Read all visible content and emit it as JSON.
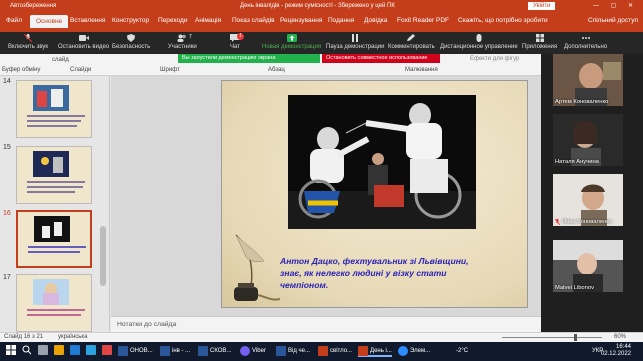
{
  "title_bar": {
    "autosave": "Автозбереження",
    "doc_title": "День інвалідів  -  режим сумісності  -  Збережено у цей ПК",
    "signin": "Увійти",
    "window_controls": "— ▢ ✕"
  },
  "ribbon_tabs": {
    "items": [
      "Файл",
      "Основне",
      "Вставлення",
      "Конструктор",
      "Переходи",
      "Анімація",
      "Показ слайдів",
      "Рецензування",
      "Подання",
      "Довідка",
      "Foxit Reader PDF"
    ],
    "active": "Основне",
    "tell_me": "Скажіть, що потрібно зробити",
    "share": "Спільний доступ"
  },
  "zoom_toolbar": {
    "items": [
      {
        "label": "Включить звук",
        "icon": "microphone-muted-icon"
      },
      {
        "label": "Остановить видео",
        "icon": "video-camera-icon"
      },
      {
        "label": "Безопасность",
        "icon": "shield-icon"
      },
      {
        "label": "Участники",
        "icon": "participants-icon",
        "count": "7"
      },
      {
        "label": "Чат",
        "icon": "chat-icon",
        "badge": "1"
      },
      {
        "label": "Новая демонстрация",
        "icon": "share-screen-icon"
      },
      {
        "label": "Пауза демонстрации",
        "icon": "pause-icon"
      },
      {
        "label": "Комментировать",
        "icon": "annotate-icon"
      },
      {
        "label": "Дистанционное управление",
        "icon": "remote-control-icon"
      },
      {
        "label": "Приложения",
        "icon": "apps-icon"
      },
      {
        "label": "Дополнительно",
        "icon": "more-icon"
      }
    ]
  },
  "ribbon_body": {
    "clipboard": "Буфер обміну",
    "slides": "Слайди",
    "slide_dropdown": "слайд",
    "font": "Шрифт",
    "paragraph": "Абзац",
    "drawing": "Малювання",
    "effects": "Ефекти для фігур",
    "share_banner": "Вы запустили демонстрацию экрана",
    "stop_banner": "Остановить совместное использование"
  },
  "thumbnails": [
    {
      "num": "14",
      "selected": false
    },
    {
      "num": "15",
      "selected": false
    },
    {
      "num": "16",
      "selected": true
    },
    {
      "num": "17",
      "selected": false
    }
  ],
  "slide": {
    "caption": "Антон Дацко, фехтувальник зі Львівщини, знає, як нелегко людині у візку стати чемпіоном.",
    "photo_icon": "wheelchair-fencing-photo"
  },
  "notes": "Нотатки до слайда",
  "participants": [
    {
      "name": "Артем Коноваленко",
      "muted": false
    },
    {
      "name": "Наталя Анучина",
      "muted": false
    },
    {
      "name": "Иван Коноваленко",
      "muted": true
    },
    {
      "name": "Matvei Libonov",
      "muted": false
    }
  ],
  "status_bar": {
    "slide_pos": "Слайд 16 з 21",
    "language": "українська",
    "zoom": "60%"
  },
  "taskbar": {
    "items": [
      {
        "label": "ОНОВ...",
        "color": "#2b579a"
      },
      {
        "label": "інв - ...",
        "color": "#2b579a"
      },
      {
        "label": "СКОВ...",
        "color": "#2b579a"
      },
      {
        "label": "Viber",
        "color": "#7360f2"
      },
      {
        "label": "Від че...",
        "color": "#2b579a"
      },
      {
        "label": "світло...",
        "color": "#c43e1c"
      },
      {
        "label": "День і...",
        "color": "#c43e1c"
      },
      {
        "label": "Элем...",
        "color": "#2d8cff"
      }
    ],
    "weather": "-2°C",
    "lang": "УКР",
    "time": "16:44",
    "date": "02.12.2022"
  }
}
